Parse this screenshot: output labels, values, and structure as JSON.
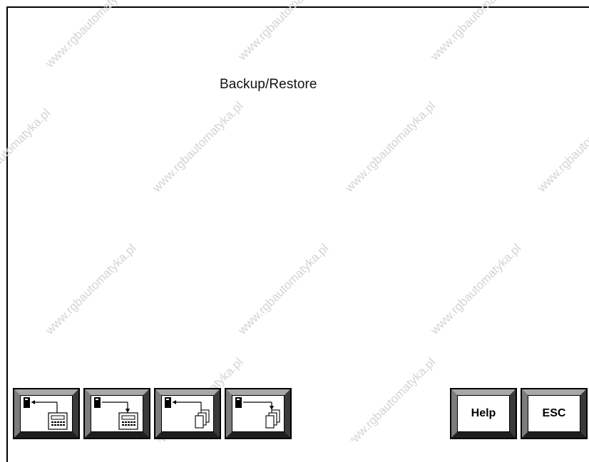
{
  "screen": {
    "title": "Backup/Restore",
    "watermark_text": "www.rgbautomatyka.pl"
  },
  "function_keys": [
    {
      "name": "backup-to-terminal",
      "icon": "drive-to-terminal-icon"
    },
    {
      "name": "restore-from-terminal",
      "icon": "terminal-to-drive-icon"
    },
    {
      "name": "backup-to-files",
      "icon": "drive-to-files-icon"
    },
    {
      "name": "restore-from-files",
      "icon": "files-to-drive-icon"
    }
  ],
  "help_key": {
    "label": "Help"
  },
  "esc_key": {
    "label": "ESC"
  }
}
